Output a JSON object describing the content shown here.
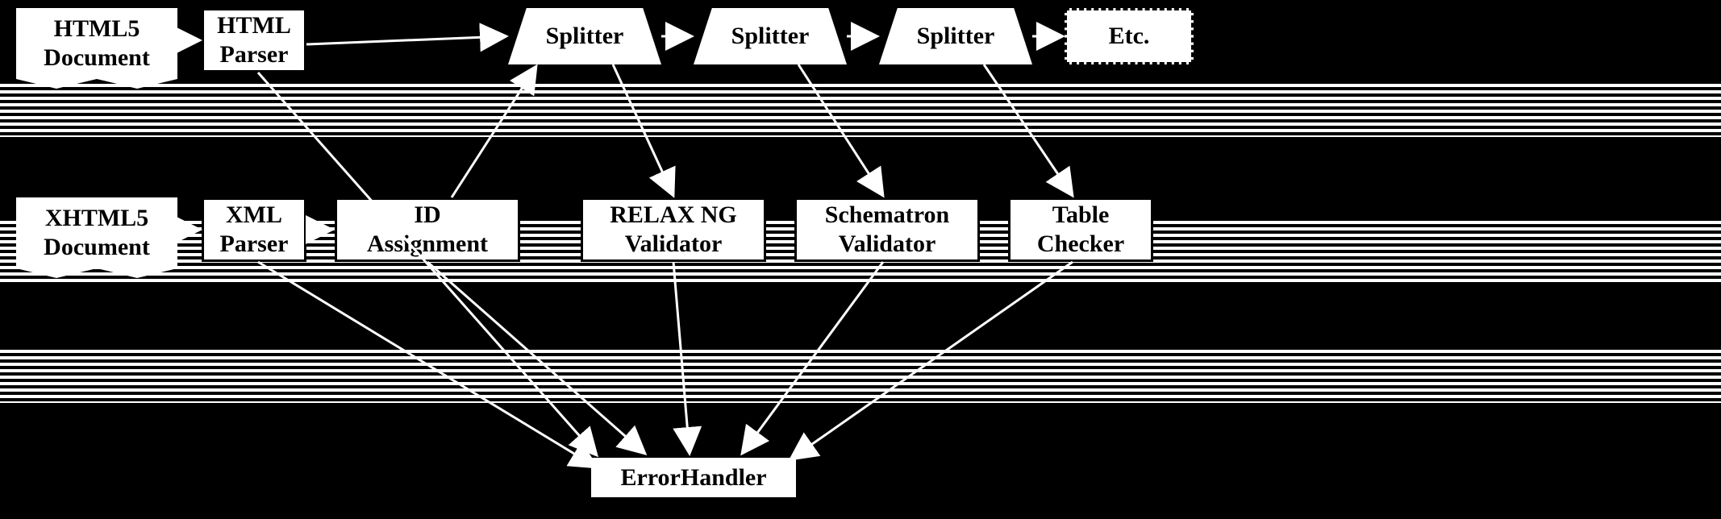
{
  "nodes": {
    "html5_doc": "HTML5\nDocument",
    "html_parser": "HTML\nParser",
    "splitter1": "Splitter",
    "splitter2": "Splitter",
    "splitter3": "Splitter",
    "etc": "Etc.",
    "xhtml5_doc": "XHTML5\nDocument",
    "xml_parser": "XML\nParser",
    "id_assignment": "ID\nAssignment",
    "relax_ng": "RELAX NG\nValidator",
    "schematron": "Schematron\nValidator",
    "table_checker": "Table\nChecker",
    "error_handler": "ErrorHandler"
  }
}
